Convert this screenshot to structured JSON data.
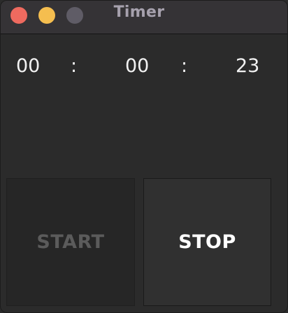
{
  "window": {
    "title": "Timer",
    "controls": {
      "close_color": "#ee6a5f",
      "minimize_color": "#f5be4f",
      "zoom_color": "#5f5c66"
    }
  },
  "timer": {
    "hours": "00",
    "separator_1": ":",
    "minutes": "00",
    "separator_2": ":",
    "seconds": "23"
  },
  "buttons": {
    "start_label": "START",
    "start_state": "disabled",
    "stop_label": "STOP"
  }
}
